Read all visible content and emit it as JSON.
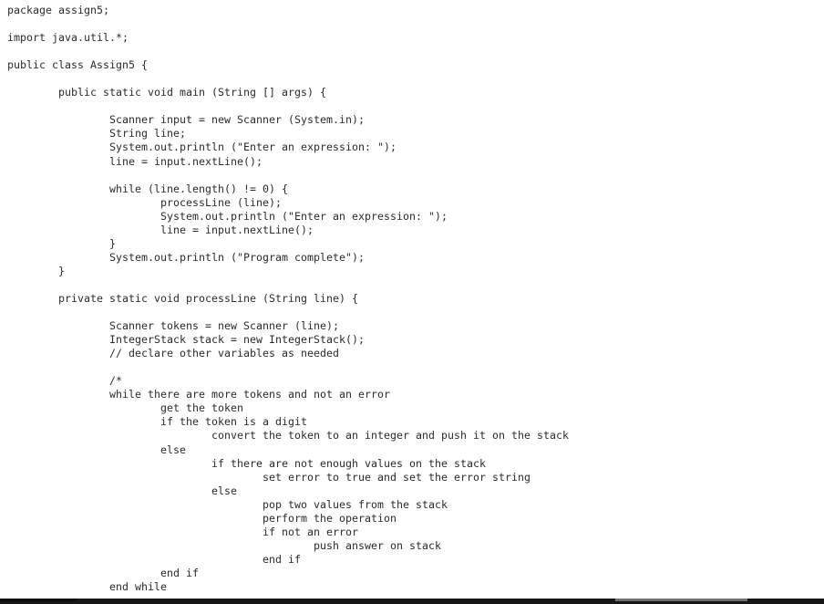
{
  "document": {
    "type": "java-source-listing",
    "background_color": "#ffffff",
    "text_color": "#2b2b2b",
    "font_kind": "monospace",
    "package": "assign5",
    "class_name": "Assign5",
    "bottom_edge_color": "#161616",
    "scrollbar_thumb_color": "#6f6f6f"
  },
  "code": {
    "lines": [
      "package assign5;",
      "",
      "import java.util.*;",
      "",
      "public class Assign5 {",
      "",
      "        public static void main (String [] args) {",
      "",
      "                Scanner input = new Scanner (System.in);",
      "                String line;",
      "                System.out.println (\"Enter an expression: \");",
      "                line = input.nextLine();",
      "",
      "                while (line.length() != 0) {",
      "                        processLine (line);",
      "                        System.out.println (\"Enter an expression: \");",
      "                        line = input.nextLine();",
      "                }",
      "                System.out.println (\"Program complete\");",
      "        }",
      "",
      "        private static void processLine (String line) {",
      "",
      "                Scanner tokens = new Scanner (line);",
      "                IntegerStack stack = new IntegerStack();",
      "                // declare other variables as needed",
      "",
      "                /*",
      "                while there are more tokens and not an error",
      "                        get the token",
      "                        if the token is a digit",
      "                                convert the token to an integer and push it on the stack",
      "                        else",
      "                                if there are not enough values on the stack",
      "                                        set error to true and set the error string",
      "                                else",
      "                                        pop two values from the stack",
      "                                        perform the operation",
      "                                        if not an error",
      "                                                push answer on stack",
      "                                        end if",
      "                        end if",
      "                end while"
    ]
  }
}
